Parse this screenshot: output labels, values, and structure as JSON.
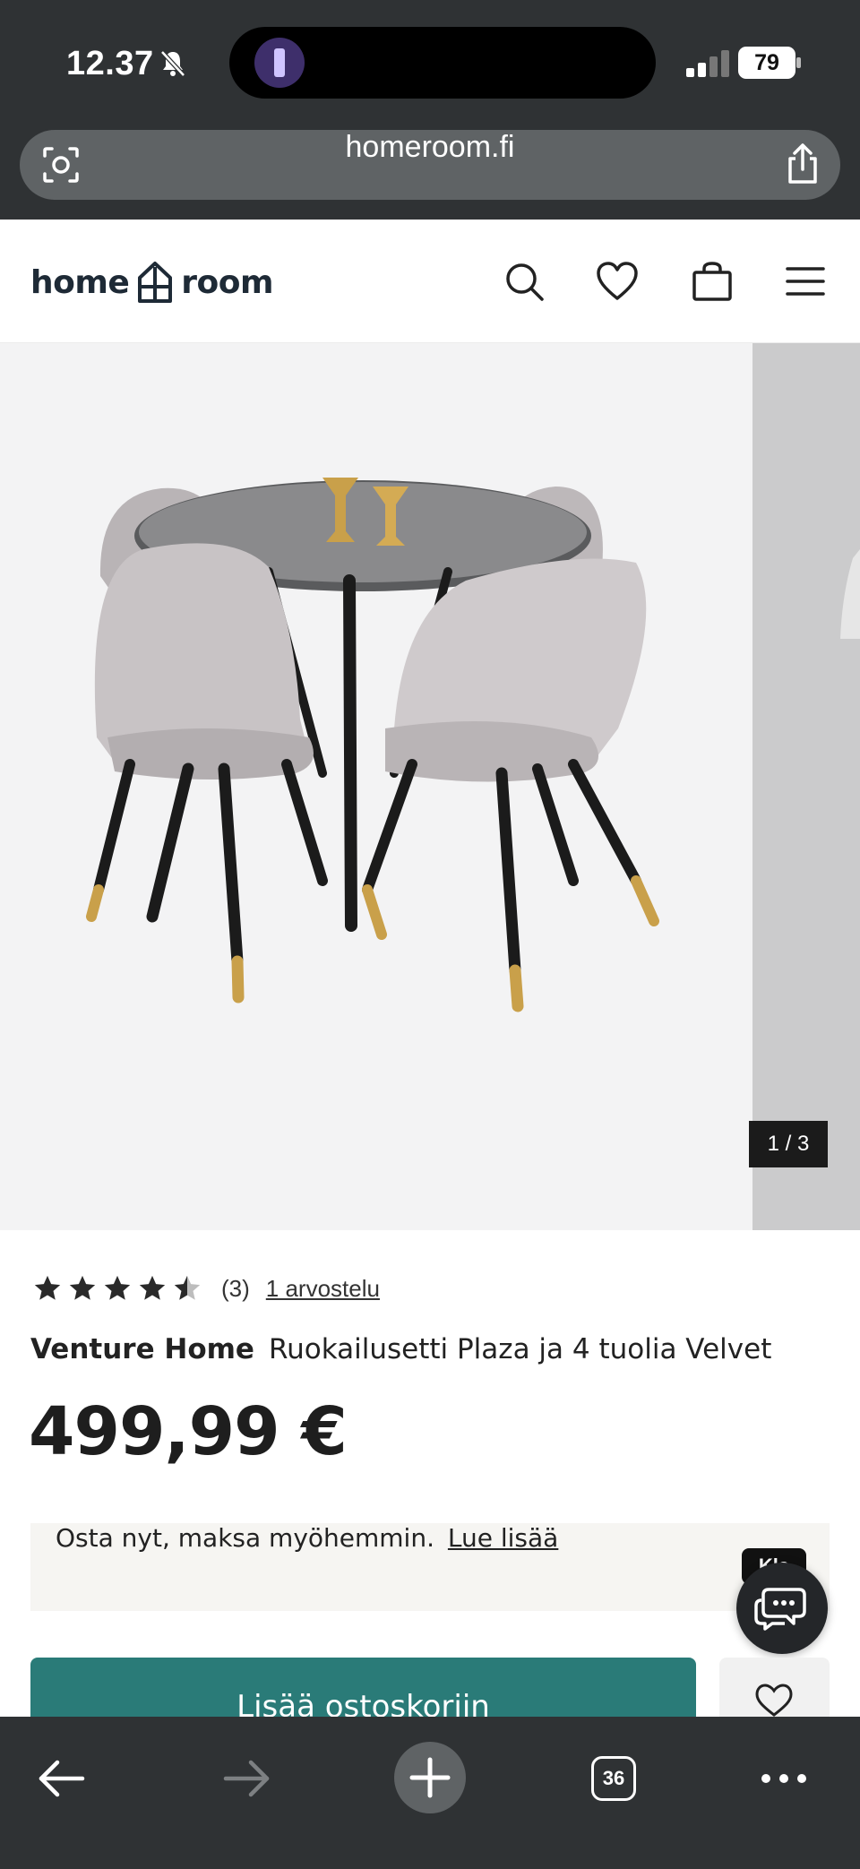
{
  "status_bar": {
    "time": "12.37",
    "battery": "79",
    "icons": [
      "bell-slash-icon",
      "flashlight-icon",
      "cellular-signal-icon",
      "battery-icon"
    ]
  },
  "browser": {
    "url": "homeroom.fi",
    "icons": [
      "visual-search-icon",
      "share-icon"
    ]
  },
  "header": {
    "logo_left": "home",
    "logo_right": "room",
    "icons": [
      "search-icon",
      "heart-icon",
      "shopping-bag-icon",
      "menu-icon"
    ]
  },
  "gallery": {
    "counter": "1 / 3",
    "current_image": 1,
    "total_images": 3
  },
  "product": {
    "rating_value": 4.5,
    "rating_max": 5,
    "rating_count": "(3)",
    "reviews_link": "1 arvostelu",
    "brand": "Venture Home",
    "name": "Ruokailusetti Plaza ja 4 tuolia Velvet",
    "price": "499,99 €"
  },
  "klarna": {
    "text": "Osta nyt, maksa myöhemmin.",
    "link": "Lue lisää",
    "badge": "Kla"
  },
  "actions": {
    "add_to_cart": "Lisää ostoskoriin"
  },
  "toolbar": {
    "tabs_count": "36",
    "icons": [
      "back-arrow-icon",
      "forward-arrow-icon",
      "new-tab-plus-icon",
      "tabs-icon",
      "more-icon"
    ]
  }
}
